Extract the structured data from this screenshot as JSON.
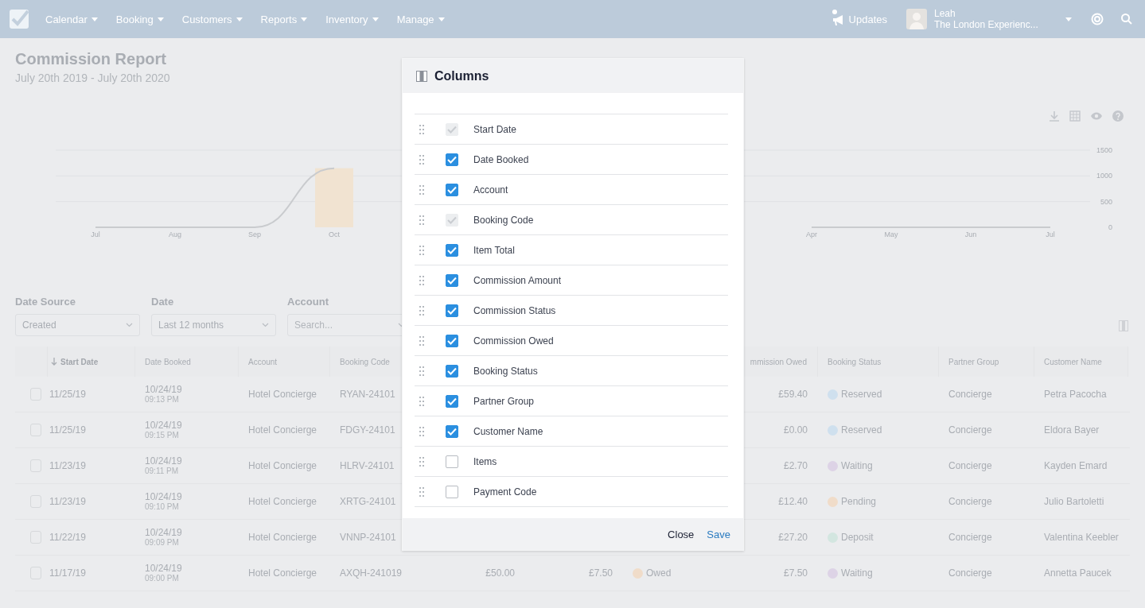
{
  "nav": {
    "menu": [
      {
        "label": "Calendar"
      },
      {
        "label": "Booking"
      },
      {
        "label": "Customers"
      },
      {
        "label": "Reports"
      },
      {
        "label": "Inventory"
      },
      {
        "label": "Manage"
      }
    ],
    "updates": "Updates",
    "user": {
      "name": "Leah",
      "company": "The London Experienc..."
    }
  },
  "page": {
    "title": "Commission Report",
    "subtitle": "July 20th 2019 - July 20th 2020"
  },
  "chart": {
    "chart_data": {
      "type": "bar",
      "ylim": [
        0,
        1500
      ],
      "yticks": [
        0,
        500,
        1000,
        1500
      ],
      "categories": [
        "Jul",
        "Aug",
        "Sep",
        "Oct",
        null,
        null,
        null,
        null,
        null,
        "Apr",
        "May",
        "Jun",
        "Jul"
      ],
      "series": [
        {
          "color": "#f1e3d1",
          "values": [
            null,
            null,
            null,
            1150,
            null,
            null,
            null,
            null,
            null,
            null,
            null,
            null,
            null
          ]
        },
        {
          "type": "line",
          "color": "#c9cbce",
          "values": [
            0,
            0,
            0,
            1150,
            null,
            null,
            null,
            null,
            null,
            0,
            0,
            0,
            0
          ]
        }
      ]
    }
  },
  "filters": [
    {
      "label": "Date Source",
      "value": "Created"
    },
    {
      "label": "Date",
      "value": "Last 12 months"
    },
    {
      "label": "Account",
      "placeholder": "Search..."
    }
  ],
  "table": {
    "columns": [
      {
        "label": "Start Date",
        "sorted": true
      },
      {
        "label": "Date Booked",
        "sorted": false
      },
      {
        "label": "Account",
        "sorted": false
      },
      {
        "label": "Booking Code",
        "sorted": false
      },
      {
        "label": "mmission Owed",
        "sorted": false
      },
      {
        "label": "Booking Status",
        "sorted": false
      },
      {
        "label": "Partner Group",
        "sorted": false
      },
      {
        "label": "Customer Name",
        "sorted": false
      }
    ],
    "rows": [
      {
        "checked": false,
        "start_date": "11/25/19",
        "date_booked": "10/24/19",
        "time_booked": "09:13 PM",
        "account": "Hotel Concierge",
        "booking_code": "RYAN-24101",
        "commission_owed": "£59.40",
        "booking_status": {
          "label": "Reserved",
          "color": "#cfe0ee"
        },
        "partner_group": "Concierge",
        "customer_name": "Petra Pacocha"
      },
      {
        "checked": false,
        "start_date": "11/25/19",
        "date_booked": "10/24/19",
        "time_booked": "09:15 PM",
        "account": "Hotel Concierge",
        "booking_code": "FDGY-24101",
        "commission_owed": "£0.00",
        "booking_status": {
          "label": "Reserved",
          "color": "#cfe0ee"
        },
        "partner_group": "Concierge",
        "customer_name": "Eldora Bayer"
      },
      {
        "checked": false,
        "start_date": "11/23/19",
        "date_booked": "10/24/19",
        "time_booked": "09:11 PM",
        "account": "Hotel Concierge",
        "booking_code": "HLRV-24101",
        "commission_owed": "£2.70",
        "booking_status": {
          "label": "Waiting",
          "color": "#ddd3e6"
        },
        "partner_group": "Concierge",
        "customer_name": "Kayden Emard"
      },
      {
        "checked": false,
        "start_date": "11/23/19",
        "date_booked": "10/24/19",
        "time_booked": "09:10 PM",
        "account": "Hotel Concierge",
        "booking_code": "XRTG-24101",
        "commission_owed": "£12.40",
        "booking_status": {
          "label": "Pending",
          "color": "#f0dcc9"
        },
        "partner_group": "Concierge",
        "customer_name": "Julio Bartoletti"
      },
      {
        "checked": false,
        "start_date": "11/22/19",
        "date_booked": "10/24/19",
        "time_booked": "09:09 PM",
        "account": "Hotel Concierge",
        "booking_code": "VNNP-24101",
        "commission_owed": "£27.20",
        "booking_status": {
          "label": "Deposit",
          "color": "#d3e6e0"
        },
        "partner_group": "Concierge",
        "customer_name": "Valentina Keebler"
      },
      {
        "checked": false,
        "start_date": "11/17/19",
        "date_booked": "10/24/19",
        "time_booked": "09:00 PM",
        "account": "Hotel Concierge",
        "booking_code": "AXQH-241019",
        "item_total": "£50.00",
        "commission_amount": "£7.50",
        "commission_status": {
          "label": "Owed",
          "color": "#f0dcc9"
        },
        "commission_owed": "£7.50",
        "booking_status": {
          "label": "Waiting",
          "color": "#ddd3e6"
        },
        "partner_group": "Concierge",
        "customer_name": "Annetta Paucek"
      }
    ]
  },
  "modal": {
    "title": "Columns",
    "items": [
      {
        "label": "Start Date",
        "checked": true,
        "disabled": true
      },
      {
        "label": "Date Booked",
        "checked": true,
        "disabled": false
      },
      {
        "label": "Account",
        "checked": true,
        "disabled": false
      },
      {
        "label": "Booking Code",
        "checked": true,
        "disabled": true
      },
      {
        "label": "Item Total",
        "checked": true,
        "disabled": false
      },
      {
        "label": "Commission Amount",
        "checked": true,
        "disabled": false
      },
      {
        "label": "Commission Status",
        "checked": true,
        "disabled": false
      },
      {
        "label": "Commission Owed",
        "checked": true,
        "disabled": false
      },
      {
        "label": "Booking Status",
        "checked": true,
        "disabled": false
      },
      {
        "label": "Partner Group",
        "checked": true,
        "disabled": false
      },
      {
        "label": "Customer Name",
        "checked": true,
        "disabled": false
      },
      {
        "label": "Items",
        "checked": false,
        "disabled": false
      },
      {
        "label": "Payment Code",
        "checked": false,
        "disabled": false
      }
    ],
    "buttons": [
      {
        "label": "Close",
        "kind": "secondary"
      },
      {
        "label": "Save",
        "kind": "primary"
      }
    ]
  }
}
